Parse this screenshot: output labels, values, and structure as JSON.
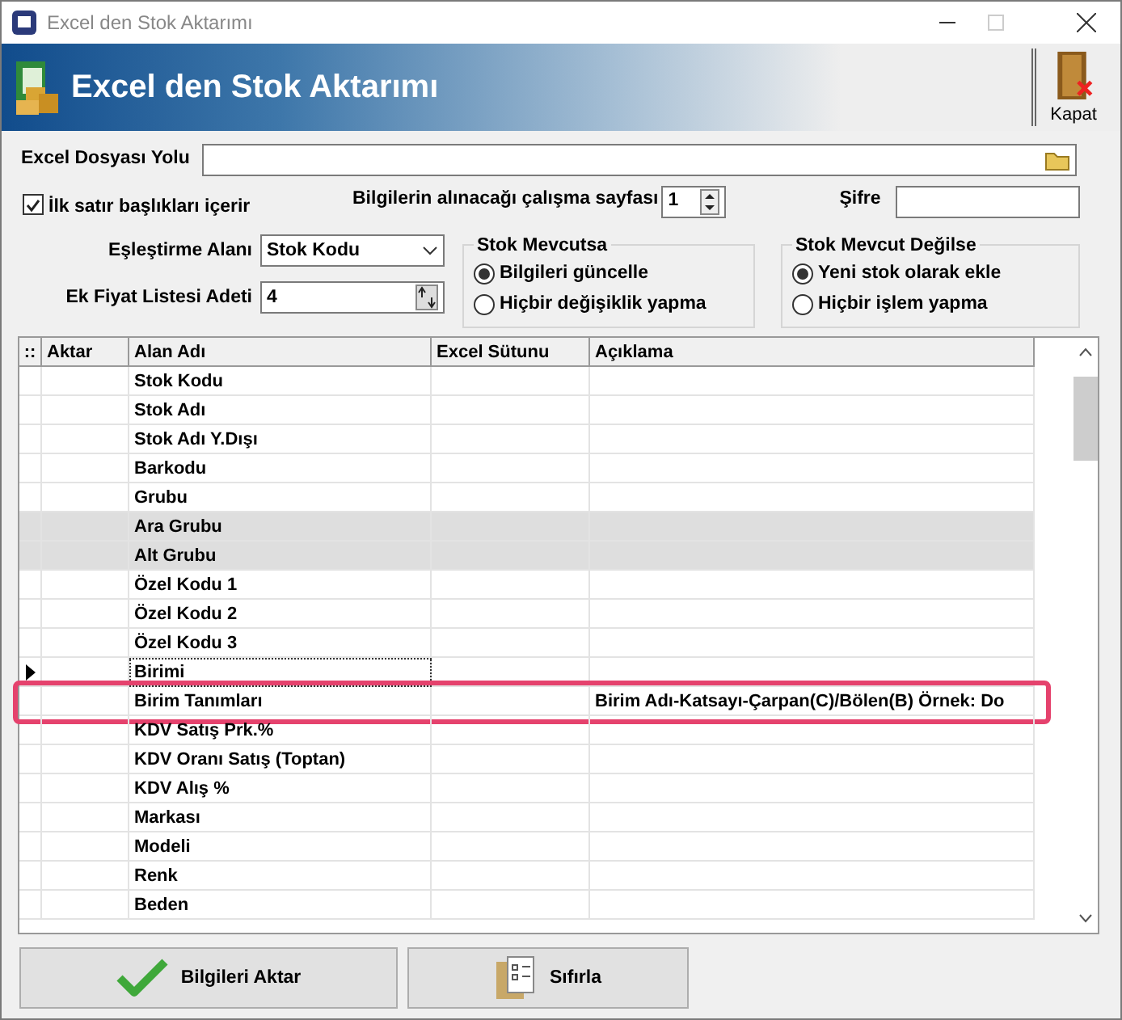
{
  "window": {
    "title": "Excel den Stok Aktarımı"
  },
  "header": {
    "title": "Excel den Stok Aktarımı",
    "close_button": "Kapat"
  },
  "file_path": {
    "label": "Excel Dosyası Yolu"
  },
  "first_row_headers": {
    "label": "İlk satır başlıkları içerir",
    "checked": true
  },
  "sheet": {
    "label": "Bilgilerin alınacağı çalışma sayfası",
    "value": "1"
  },
  "password": {
    "label": "Şifre"
  },
  "match_field": {
    "label": "Eşleştirme Alanı",
    "value": "Stok Kodu"
  },
  "extra_price_lists": {
    "label": "Ek Fiyat Listesi Adeti",
    "value": "4"
  },
  "radio_groups": [
    {
      "title": "Stok Mevcutsa",
      "options": [
        {
          "label": "Bilgileri güncelle",
          "selected": true
        },
        {
          "label": "Hiçbir değişiklik yapma",
          "selected": false
        }
      ]
    },
    {
      "title": "Stok Mevcut Değilse",
      "options": [
        {
          "label": "Yeni stok olarak ekle",
          "selected": true
        },
        {
          "label": "Hiçbir işlem yapma",
          "selected": false
        }
      ]
    }
  ],
  "grid": {
    "columns": [
      "::",
      "Aktar",
      "Alan Adı",
      "Excel Sütunu",
      "Açıklama"
    ],
    "rows": [
      {
        "field": "Stok Kodu",
        "shaded": false,
        "current": false,
        "highlighted": false
      },
      {
        "field": "Stok Adı",
        "shaded": false,
        "current": false,
        "highlighted": false
      },
      {
        "field": "Stok Adı Y.Dışı",
        "shaded": false,
        "current": false,
        "highlighted": false
      },
      {
        "field": "Barkodu",
        "shaded": false,
        "current": false,
        "highlighted": false
      },
      {
        "field": "Grubu",
        "shaded": false,
        "current": false,
        "highlighted": false
      },
      {
        "field": "Ara Grubu",
        "shaded": true,
        "current": false,
        "highlighted": false
      },
      {
        "field": "Alt Grubu",
        "shaded": true,
        "current": false,
        "highlighted": false
      },
      {
        "field": "Özel Kodu 1",
        "shaded": false,
        "current": false,
        "highlighted": false
      },
      {
        "field": "Özel Kodu 2",
        "shaded": false,
        "current": false,
        "highlighted": false
      },
      {
        "field": "Özel Kodu 3",
        "shaded": false,
        "current": false,
        "highlighted": false
      },
      {
        "field": "Birimi",
        "shaded": false,
        "current": true,
        "highlighted": false
      },
      {
        "field": "Birim Tanımları",
        "description": "Birim Adı-Katsayı-Çarpan(C)/Bölen(B) Örnek: Do",
        "shaded": false,
        "current": false,
        "highlighted": true
      },
      {
        "field": "KDV Satış Prk.%",
        "shaded": false,
        "current": false,
        "highlighted": false
      },
      {
        "field": "KDV Oranı Satış (Toptan)",
        "shaded": false,
        "current": false,
        "highlighted": false
      },
      {
        "field": "KDV Alış %",
        "shaded": false,
        "current": false,
        "highlighted": false
      },
      {
        "field": "Markası",
        "shaded": false,
        "current": false,
        "highlighted": false
      },
      {
        "field": "Modeli",
        "shaded": false,
        "current": false,
        "highlighted": false
      },
      {
        "field": "Renk",
        "shaded": false,
        "current": false,
        "highlighted": false
      },
      {
        "field": "Beden",
        "shaded": false,
        "current": false,
        "highlighted": false
      }
    ]
  },
  "buttons": [
    {
      "label": "Bilgileri Aktar",
      "kind": "transfer"
    },
    {
      "label": "Sıfırla",
      "kind": "reset"
    }
  ]
}
